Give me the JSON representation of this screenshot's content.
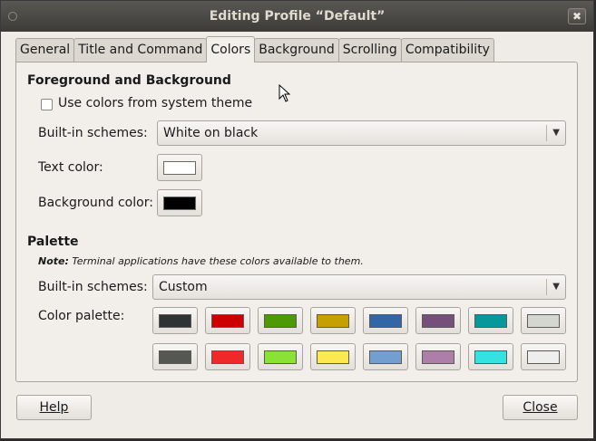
{
  "window": {
    "title": "Editing Profile “Default”",
    "close_glyph": "✖"
  },
  "tabs": [
    {
      "label": "General"
    },
    {
      "label": "Title and Command"
    },
    {
      "label": "Colors",
      "active": true
    },
    {
      "label": "Background"
    },
    {
      "label": "Scrolling"
    },
    {
      "label": "Compatibility"
    }
  ],
  "fg_bg": {
    "heading": "Foreground and Background",
    "use_system": {
      "label": "Use colors from system theme",
      "checked": false
    },
    "builtin_label": "Built-in schemes:",
    "builtin_value": "White on black",
    "text_color_label": "Text color:",
    "text_color": "#ffffff",
    "bg_color_label": "Background color:",
    "bg_color": "#000000"
  },
  "palette": {
    "heading": "Palette",
    "note_bold": "Note:",
    "note_text": " Terminal applications have these colors available to them.",
    "builtin_label": "Built-in schemes:",
    "builtin_value": "Custom",
    "color_palette_label": "Color palette:",
    "colors": [
      "#2e3436",
      "#cc0000",
      "#4e9a06",
      "#c4a000",
      "#3465a4",
      "#75507b",
      "#06989a",
      "#d3d7cf",
      "#555753",
      "#ef2929",
      "#8ae234",
      "#fce94f",
      "#729fcf",
      "#ad7fa8",
      "#34e2e2",
      "#eeeeec"
    ]
  },
  "footer": {
    "help_label": "Help",
    "close_label": "Close"
  }
}
